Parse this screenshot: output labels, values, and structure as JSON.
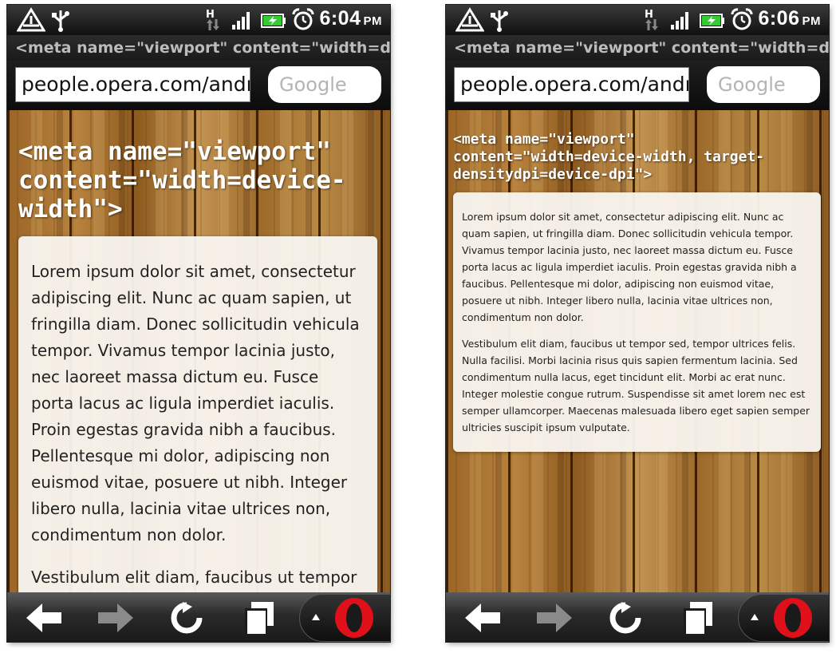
{
  "left_phone": {
    "time": "6:04",
    "ampm": "PM",
    "page_title": "<meta name=\"viewport\" content=\"width=devi...",
    "url": "people.opera.com/andrea",
    "search_placeholder": "Google",
    "heading": "<meta name=\"viewport\" content=\"width=device-width\">",
    "paragraphs": [
      "Lorem ipsum dolor sit amet, consectetur adipiscing elit. Nunc ac quam sapien, ut fringilla diam. Donec sollicitudin vehicula tempor. Vivamus tempor lacinia justo, nec laoreet massa dictum eu. Fusce porta lacus ac ligula imperdiet iaculis. Proin egestas gravida nibh a faucibus. Pellentesque mi dolor, adipiscing non euismod vitae, posuere ut nibh. Integer libero nulla, lacinia vitae ultrices non, condimentum non dolor.",
      "Vestibulum elit diam, faucibus ut tempor sed, tempor ultrices felis. Nulla facilisi."
    ]
  },
  "right_phone": {
    "time": "6:06",
    "ampm": "PM",
    "page_title": "<meta name=\"viewport\" content=\"width=devi...",
    "url": "people.opera.com/andrea",
    "search_placeholder": "Google",
    "heading": "<meta name=\"viewport\" content=\"width=device-width, target-densitydpi=device-dpi\">",
    "paragraphs": [
      "Lorem ipsum dolor sit amet, consectetur adipiscing elit. Nunc ac quam sapien, ut fringilla diam. Donec sollicitudin vehicula tempor. Vivamus tempor lacinia justo, nec laoreet massa dictum eu. Fusce porta lacus ac ligula imperdiet iaculis. Proin egestas gravida nibh a faucibus. Pellentesque mi dolor, adipiscing non euismod vitae, posuere ut nibh. Integer libero nulla, lacinia vitae ultrices non, condimentum non dolor.",
      "Vestibulum elit diam, faucibus ut tempor sed, tempor ultrices felis. Nulla facilisi. Morbi lacinia risus quis sapien fermentum lacinia. Sed condimentum nulla lacus, eget tincidunt elit. Morbi ac erat nunc. Integer molestie congue rutrum. Suspendisse sit amet lorem nec est semper ullamcorper. Maecenas malesuada libero eget sapien semper ultricies suscipit ipsum vulputate."
    ]
  },
  "status_icons": [
    "warning-icon",
    "usb-icon",
    "hspa-data-icon",
    "signal-icon",
    "battery-charging-icon",
    "alarm-icon"
  ],
  "toolbar_icons": [
    "back-arrow-icon",
    "forward-arrow-icon",
    "reload-icon",
    "tabs-icon",
    "menu-up-icon",
    "opera-logo-icon"
  ],
  "colors": {
    "battery_green": "#33cc33",
    "opera_red": "#e0101a",
    "search_placeholder": "#b4b4b4"
  }
}
